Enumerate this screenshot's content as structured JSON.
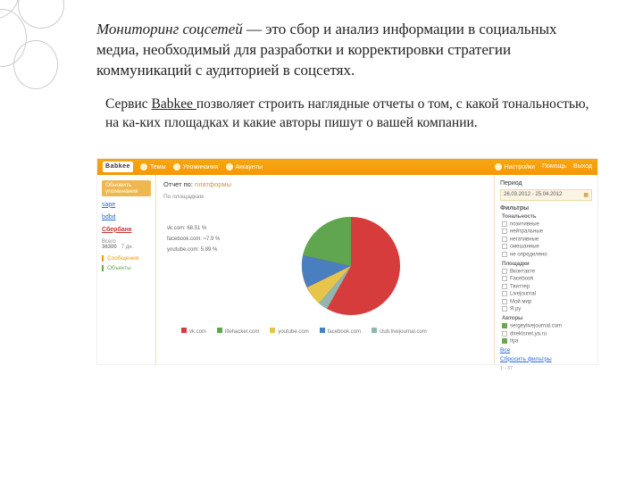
{
  "heading": {
    "term": "Мониторинг соцсетей",
    "rest": " — это сбор и анализ информации в социальных медиа, необходимый для разработки и корректировки стратегии коммуникаций с аудиторией в соцсетях."
  },
  "paragraph": {
    "prefix": "Сервис ",
    "link": "Babkee ",
    "rest": "позволяет строить наглядные отчеты о том, с какой тональностью, на ка-ких площадках и какие авторы пишут о вашей компании."
  },
  "app": {
    "logo": "Babkee",
    "nav": {
      "item1": "Темы",
      "item2": "Упоминания",
      "item3": "Аккаунты",
      "item4": "Настройки",
      "item5": "Помощь",
      "item6": "Выход"
    },
    "sidebar": {
      "button": "Обновить упоминания",
      "items": [
        "sape",
        "bdbd",
        "Сбербанк"
      ],
      "stat_label": "Всего",
      "stat_value": "36300",
      "substat": "7 дн.",
      "sub1": "Сообщения",
      "sub2": "Объекты"
    },
    "main": {
      "title_a": "Отчет по:",
      "title_b": "платформы",
      "breadcrumb": "По площадкам"
    },
    "right": {
      "period": "Период",
      "date": "26.03.2012 - 25.04.2012",
      "filters": "Фильтры",
      "tonality": "Тональность",
      "t_items": [
        "позитивные",
        "нейтральные",
        "негативные",
        "смешанные",
        "не определено"
      ],
      "platforms": "Площадки",
      "p_items": [
        "Вконтакте",
        "Facebook",
        "Твиттер",
        "Livejournal",
        "Мой мир",
        "Я.ру"
      ],
      "authors": "Авторы",
      "a_items": [
        "sergeylivejournal.com",
        "direktsnet.ya.ru",
        "Ilya"
      ],
      "all_link": "Все",
      "clear": "Сбросить фильтры",
      "count": "1 - 37"
    }
  },
  "chart_data": {
    "type": "pie",
    "title": "Отчет по платформам",
    "series": [
      {
        "name": "vk.com",
        "value": 68.51,
        "color": "#d73c3c",
        "label": "vk.com: 68.51 %"
      },
      {
        "name": "lifehacker.com",
        "value": 15.86,
        "color": "#5fa64f",
        "label": "lifehacker.com: 15.86 %"
      },
      {
        "name": "facebook.com",
        "value": 7.9,
        "color": "#4a7fbf",
        "label": "facebook.com: ≈7.9 %"
      },
      {
        "name": "youtube.com",
        "value": 5.89,
        "color": "#e7c54a",
        "label": "youtube.com: 5.89 %"
      },
      {
        "name": "club.livejournal.com",
        "value": 1.84,
        "color": "#8fb6b0",
        "label": "club.livejournal.com: ≈1.84 %"
      }
    ],
    "legend": [
      "vk.com",
      "lifehacker.com",
      "youtube.com",
      "facebook.com",
      "club.livejournal.com"
    ]
  }
}
